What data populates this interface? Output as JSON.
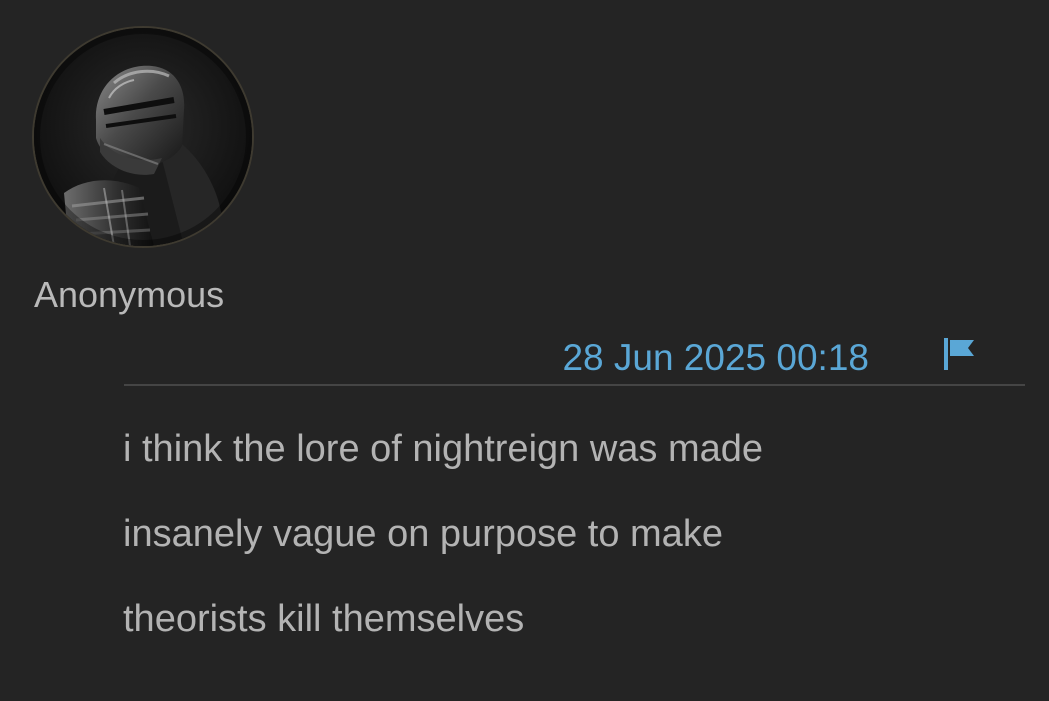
{
  "post": {
    "author": "Anonymous",
    "avatar_icon": "knight-helmet-avatar",
    "timestamp": "28 Jun 2025 00:18",
    "report_icon": "flag-icon",
    "body_lines": [
      "i think the lore of nightreign was made",
      "insanely vague on purpose to make",
      "theorists kill themselves"
    ]
  },
  "colors": {
    "background": "#242424",
    "text": "#b3b3b3",
    "timestamp": "#5aa7d6",
    "divider": "#454545"
  }
}
